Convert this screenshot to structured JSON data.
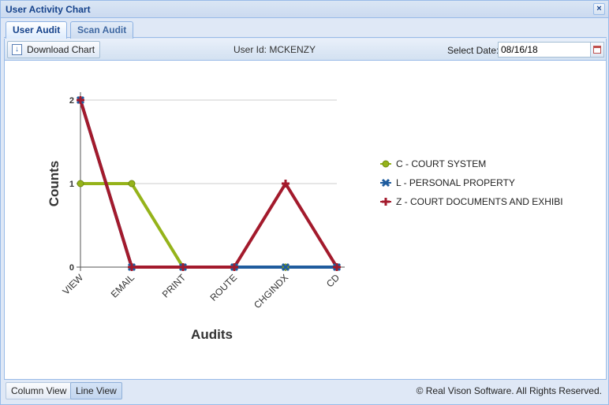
{
  "window": {
    "title": "User Activity Chart"
  },
  "tabs": [
    {
      "label": "User Audit",
      "active": true
    },
    {
      "label": "Scan Audit",
      "active": false
    }
  ],
  "toolbar": {
    "download_label": "Download Chart",
    "user_id": "User Id: MCKENZY",
    "date_label": "Select Date:",
    "date_value": "08/16/18"
  },
  "footer": {
    "column_view_label": "Column View",
    "line_view_label": "Line View",
    "copyright": "© Real Vison Software. All Rights Reserved."
  },
  "chart_data": {
    "type": "line",
    "categories": [
      "VIEW",
      "EMAIL",
      "PRINT",
      "ROUTE",
      "CHGINDX",
      "CD"
    ],
    "series": [
      {
        "name": "C - COURT SYSTEM",
        "values": [
          1,
          1,
          0,
          0,
          0,
          0
        ],
        "color": "#95b31a",
        "marker": "circle"
      },
      {
        "name": "L - PERSONAL PROPERTY",
        "values": [
          2,
          0,
          0,
          0,
          0,
          0
        ],
        "color": "#1f5c9e",
        "marker": "x"
      },
      {
        "name": "Z - COURT DOCUMENTS AND EXHIBI",
        "values": [
          2,
          0,
          0,
          0,
          1,
          0
        ],
        "color": "#a31a2c",
        "marker": "plus"
      }
    ],
    "xlabel": "Audits",
    "ylabel": "Counts",
    "ylim": [
      0,
      2
    ],
    "yticks": [
      "0",
      "1",
      "2"
    ],
    "grid": true,
    "legend_position": "right"
  }
}
